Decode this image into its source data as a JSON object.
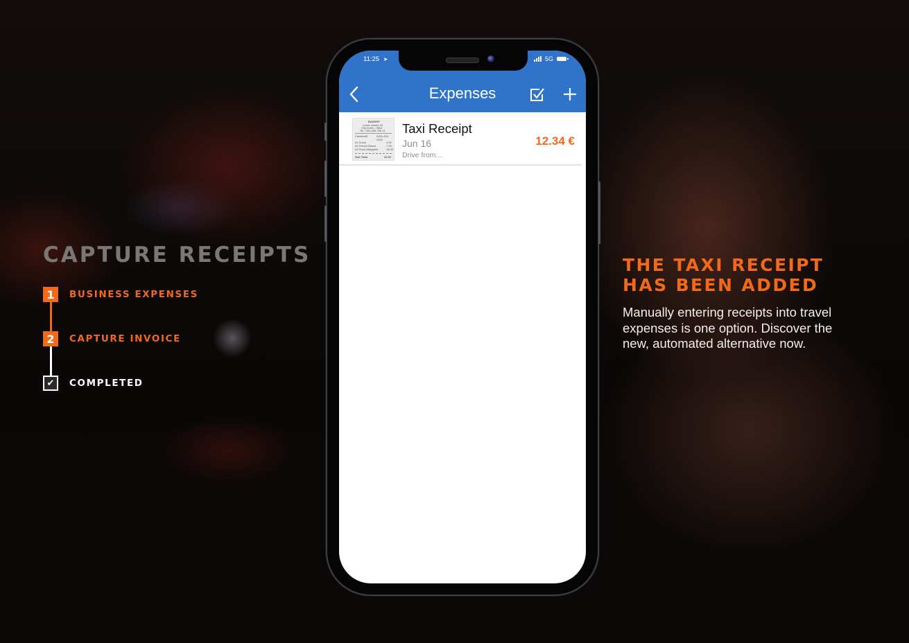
{
  "left_panel": {
    "title": "CAPTURE RECEIPTS",
    "steps": [
      {
        "number": "1",
        "label": "BUSINESS EXPENSES",
        "state": "active"
      },
      {
        "number": "2",
        "label": "CAPTURE INVOICE",
        "state": "active"
      },
      {
        "number": "",
        "label": "COMPLETED",
        "state": "done",
        "icon": "checkbox-checked-icon"
      }
    ]
  },
  "right_panel": {
    "heading_line1": "THE TAXI RECEIPT",
    "heading_line2": "HAS BEEN ADDED",
    "body": "Manually entering receipts into travel expenses is one option. Discover the new, automated alternative now."
  },
  "phone": {
    "status_bar": {
      "time": "11:25",
      "location_icon": "location-arrow-icon",
      "network": "5G",
      "signal_icon": "signal-bars-icon",
      "battery_icon": "battery-icon"
    },
    "nav": {
      "title": "Expenses",
      "back_icon": "chevron-left-icon",
      "select_icon": "checkbox-select-icon",
      "add_icon": "plus-icon"
    },
    "expenses": [
      {
        "title": "Taxi Receipt",
        "date": "Jun 16",
        "description": "Drive from...",
        "amount": "12.34 €",
        "thumbnail": {
          "store": "BAKERY",
          "lines": [
            "Lorem Ipsum 44",
            "City Index - 0834",
            "Tel : 034-456-789-11"
          ],
          "cashier": "Cashier#E",
          "cashier_id": "0001-000-0000",
          "items": [
            {
              "name": "#1 Donut",
              "qty": "3",
              "price": "4.00"
            },
            {
              "name": "#2 French Bread",
              "qty": "1",
              "price": "7.00"
            },
            {
              "name": "#3 Pizza Margarita",
              "qty": "1",
              "price": "18.00"
            }
          ],
          "subtotal_label": "Sub Total",
          "subtotal": "32.00"
        }
      }
    ]
  },
  "colors": {
    "accent_orange": "#f06a1a",
    "nav_blue": "#2f74c9",
    "title_gray": "#7a7877"
  }
}
